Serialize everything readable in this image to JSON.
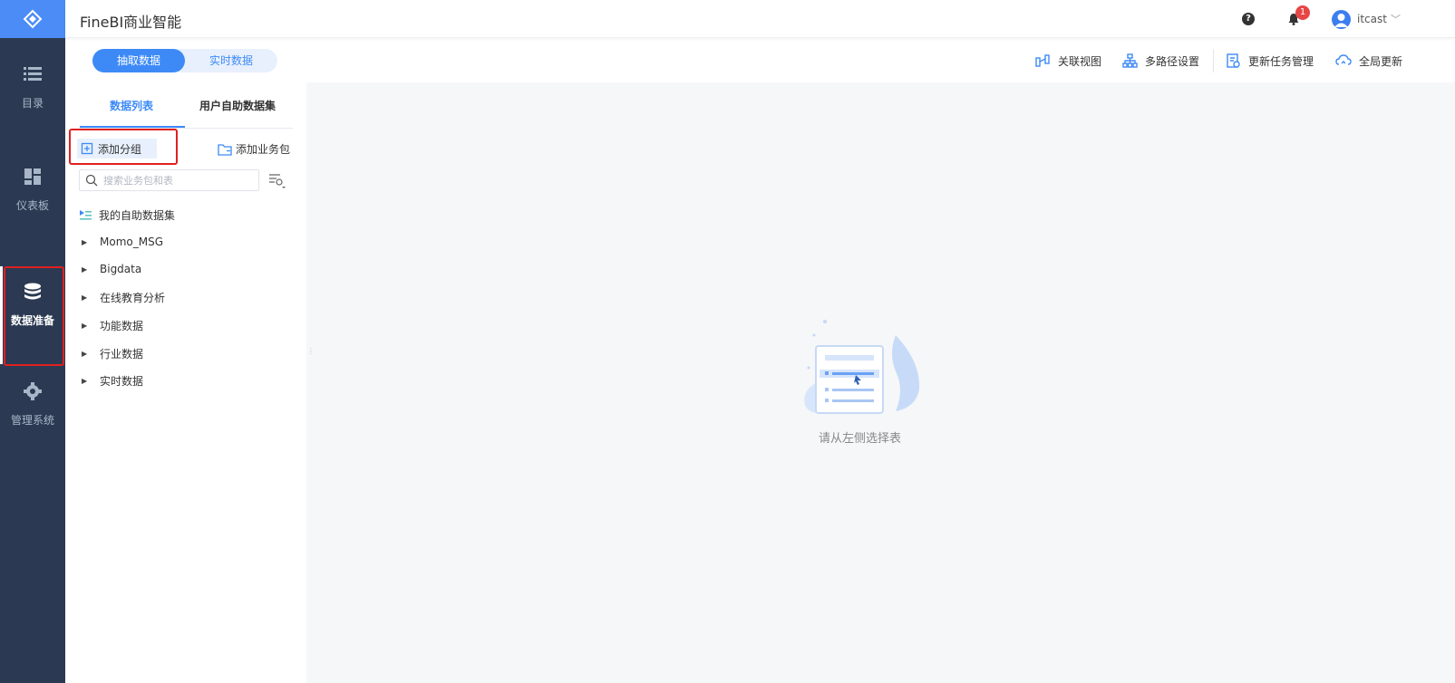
{
  "app": {
    "title": "FineBI商业智能"
  },
  "header": {
    "help_icon": "?",
    "notification_count": "1",
    "username": "itcast",
    "chevron": "﹀"
  },
  "nav": {
    "items": [
      {
        "label": "目录",
        "icon": "list-icon"
      },
      {
        "label": "仪表板",
        "icon": "dashboard-icon"
      },
      {
        "label": "数据准备",
        "icon": "database-icon",
        "active": true
      },
      {
        "label": "管理系统",
        "icon": "gear-icon"
      }
    ]
  },
  "mode_switch": {
    "extract": "抽取数据",
    "realtime": "实时数据"
  },
  "toolbar": {
    "relation_view": "关联视图",
    "multipath_settings": "多路径设置",
    "update_task": "更新任务管理",
    "global_update": "全局更新"
  },
  "panel": {
    "tabs": [
      "数据列表",
      "用户自助数据集"
    ],
    "add_group": "添加分组",
    "add_package": "添加业务包",
    "search_placeholder": "搜索业务包和表",
    "tree": [
      {
        "label": "我的自助数据集",
        "type": "dataset"
      },
      {
        "label": "Momo_MSG",
        "type": "group"
      },
      {
        "label": "Bigdata",
        "type": "group"
      },
      {
        "label": "在线教育分析",
        "type": "group"
      },
      {
        "label": "功能数据",
        "type": "group"
      },
      {
        "label": "行业数据",
        "type": "group"
      },
      {
        "label": "实时数据",
        "type": "group"
      }
    ]
  },
  "main": {
    "empty_hint": "请从左侧选择表"
  },
  "colors": {
    "primary": "#3d8af7",
    "nav_bg": "#2b3a52",
    "logo_bg": "#4b8cf7",
    "highlight": "#e02020"
  }
}
